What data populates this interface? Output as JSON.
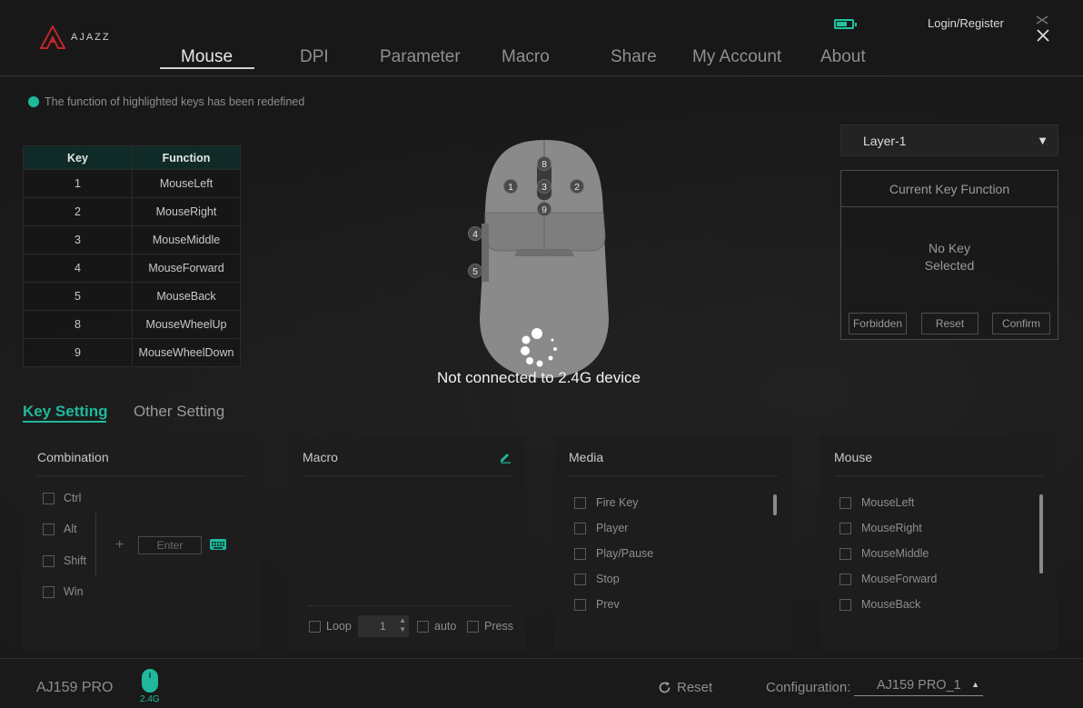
{
  "app": {
    "brand": "AJAZZ",
    "login_label": "Login/Register",
    "battery_icon": "battery-icon",
    "accent_color": "#1fb89a"
  },
  "nav": {
    "tabs": [
      {
        "label": "Mouse",
        "active": true
      },
      {
        "label": "DPI"
      },
      {
        "label": "Parameter"
      },
      {
        "label": "Macro"
      },
      {
        "label": "Share"
      },
      {
        "label": "My Account"
      },
      {
        "label": "About"
      }
    ]
  },
  "notice": "The function of highlighted keys has been redefined",
  "key_table": {
    "headers": [
      "Key",
      "Function"
    ],
    "rows": [
      [
        "1",
        "MouseLeft"
      ],
      [
        "2",
        "MouseRight"
      ],
      [
        "3",
        "MouseMiddle"
      ],
      [
        "4",
        "MouseForward"
      ],
      [
        "5",
        "MouseBack"
      ],
      [
        "8",
        "MouseWheelUp"
      ],
      [
        "9",
        "MouseWheelDown"
      ]
    ]
  },
  "mouse_badges": [
    "8",
    "1",
    "3",
    "2",
    "9",
    "4",
    "5"
  ],
  "status": "Not connected to 2.4G device",
  "layer": {
    "selected": "Layer-1"
  },
  "current_key": {
    "title": "Current Key Function",
    "line1": "No Key",
    "line2": "Selected",
    "buttons": [
      "Forbidden",
      "Reset",
      "Confirm"
    ]
  },
  "settings_tabs": {
    "key": "Key Setting",
    "other": "Other Setting"
  },
  "panels": {
    "combination": {
      "title": "Combination",
      "items": [
        "Ctrl",
        "Alt",
        "Shift",
        "Win"
      ],
      "enter_placeholder": "Enter"
    },
    "macro": {
      "title": "Macro",
      "loop_label": "Loop",
      "loop_value": "1",
      "auto_label": "auto",
      "press_label": "Press"
    },
    "media": {
      "title": "Media",
      "items": [
        "Fire Key",
        "Player",
        "Play/Pause",
        "Stop",
        "Prev"
      ]
    },
    "mouse": {
      "title": "Mouse",
      "items": [
        "MouseLeft",
        "MouseRight",
        "MouseMiddle",
        "MouseForward",
        "MouseBack"
      ]
    }
  },
  "footer": {
    "device": "AJ159 PRO",
    "connection": "2.4G",
    "reset_label": "Reset",
    "config_label": "Configuration:",
    "config_value": "AJ159 PRO_1"
  }
}
